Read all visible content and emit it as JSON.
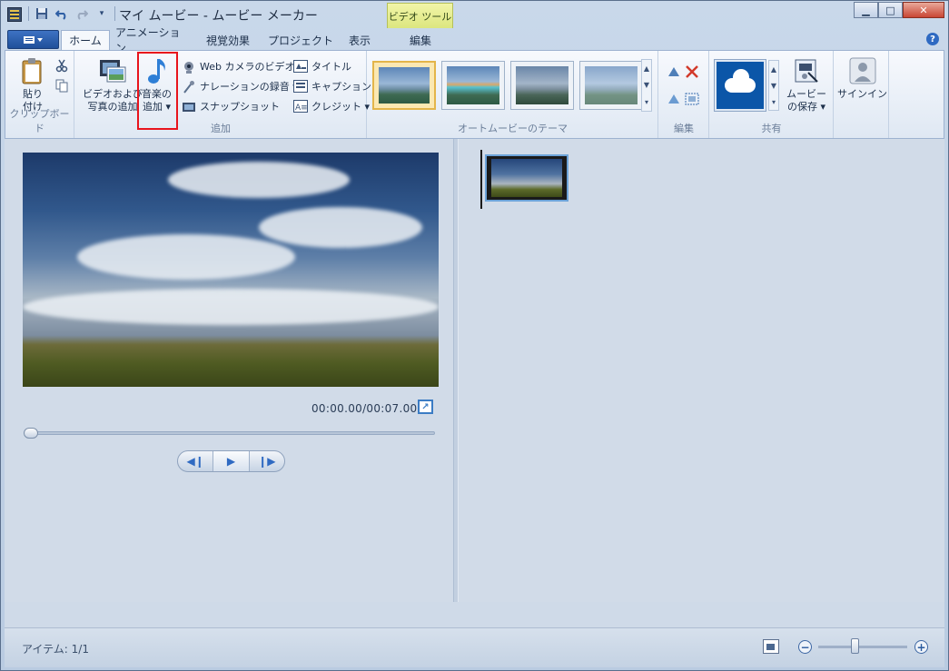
{
  "window": {
    "title": "マイ ムービー - ムービー メーカー",
    "context_tab_group": "ビデオ ツール"
  },
  "tabs": [
    {
      "label": "ホーム",
      "active": true
    },
    {
      "label": "アニメーション",
      "active": false
    },
    {
      "label": "視覚効果",
      "active": false
    },
    {
      "label": "プロジェクト",
      "active": false
    },
    {
      "label": "表示",
      "active": false
    },
    {
      "label": "編集",
      "active": false
    }
  ],
  "ribbon": {
    "clipboard": {
      "paste_label_1": "貼り",
      "paste_label_2": "付け",
      "group_label": "クリップボード"
    },
    "add": {
      "add_video_label_1": "ビデオおよび",
      "add_video_label_2": "写真の追加",
      "add_music_label_1": "音楽の",
      "add_music_label_2": "追加",
      "webcam": "Web カメラのビデオ",
      "narration": "ナレーションの録音",
      "snapshot": "スナップショット",
      "title": "タイトル",
      "caption": "キャプション",
      "credits": "クレジット",
      "group_label": "追加"
    },
    "themes": {
      "group_label": "オートムービーのテーマ",
      "count": 4,
      "selected_index": 0
    },
    "edit": {
      "group_label": "編集"
    },
    "share": {
      "save_movie_label_1": "ムービー",
      "save_movie_label_2": "の保存",
      "group_label": "共有"
    },
    "signin": {
      "label": "サインイン"
    }
  },
  "preview": {
    "timecode": "00:00.00/00:07.00",
    "seek_position": 0
  },
  "status": {
    "items": "アイテム: 1/1"
  },
  "colors": {
    "highlight_border": "#e8141c",
    "accent": "#2f6ac2",
    "file_button": "#1f4f9a"
  }
}
